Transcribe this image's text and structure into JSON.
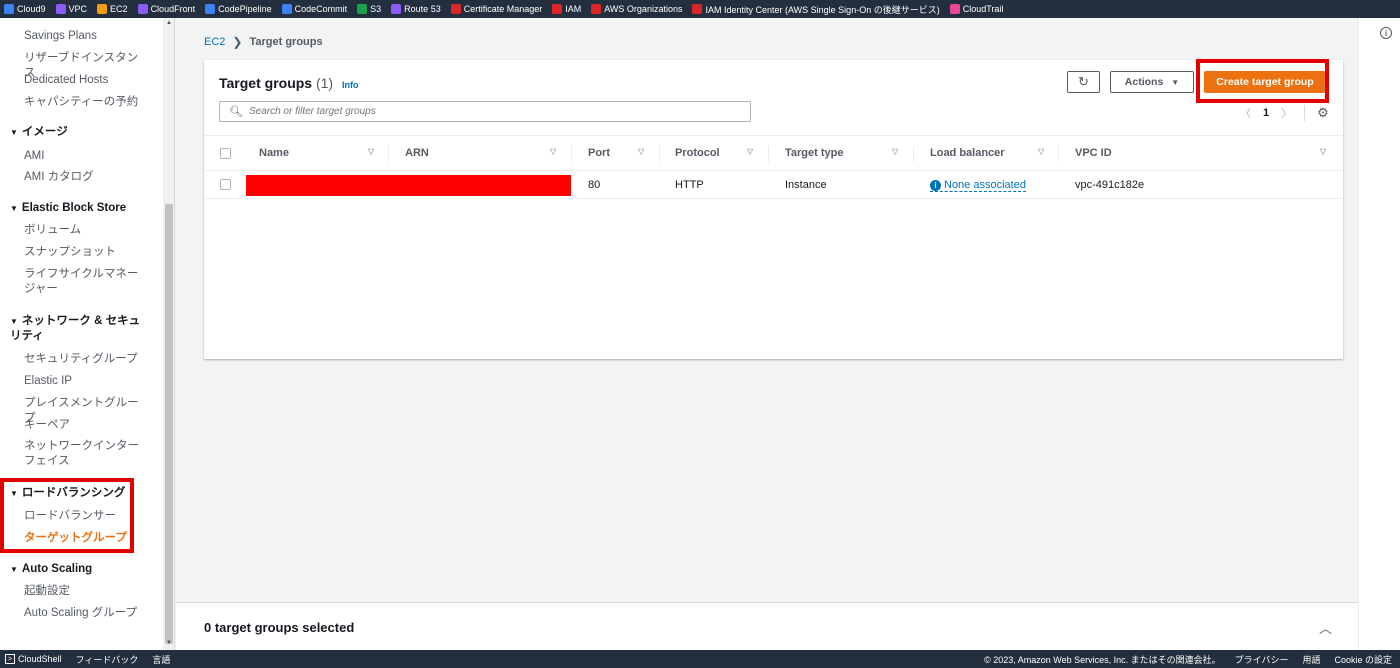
{
  "favorites": [
    {
      "label": "Cloud9",
      "color": "#3b82f6"
    },
    {
      "label": "VPC",
      "color": "#8b5cf6"
    },
    {
      "label": "EC2",
      "color": "#f59e0b"
    },
    {
      "label": "CloudFront",
      "color": "#8b5cf6"
    },
    {
      "label": "CodePipeline",
      "color": "#3b82f6"
    },
    {
      "label": "CodeCommit",
      "color": "#3b82f6"
    },
    {
      "label": "S3",
      "color": "#16a34a"
    },
    {
      "label": "Route 53",
      "color": "#8b5cf6"
    },
    {
      "label": "Certificate Manager",
      "color": "#dc2626"
    },
    {
      "label": "IAM",
      "color": "#dc2626"
    },
    {
      "label": "AWS Organizations",
      "color": "#dc2626"
    },
    {
      "label": "IAM Identity Center (AWS Single Sign-On の後継サービス)",
      "color": "#dc2626"
    },
    {
      "label": "CloudTrail",
      "color": "#ec4899"
    }
  ],
  "sidebar": {
    "items": {
      "savings": "Savings Plans",
      "reserved": "リザーブドインスタンス",
      "dedicated": "Dedicated Hosts",
      "capacity": "キャパシティーの予約",
      "images_head": "イメージ",
      "ami": "AMI",
      "ami_catalog": "AMI カタログ",
      "ebs_head": "Elastic Block Store",
      "volumes": "ボリューム",
      "snapshots": "スナップショット",
      "lifecycle": "ライフサイクルマネージャー",
      "network_head": "ネットワーク & セキュリティ",
      "sg": "セキュリティグループ",
      "eip": "Elastic IP",
      "placement": "プレイスメントグループ",
      "keypair": "キーペア",
      "eni": "ネットワークインターフェイス",
      "lb_head": "ロードバランシング",
      "lb": "ロードバランサー",
      "tg": "ターゲットグループ",
      "as_head": "Auto Scaling",
      "launch_cfg": "起動設定",
      "asg": "Auto Scaling グループ"
    }
  },
  "breadcrumb": {
    "root": "EC2",
    "sep": "❯",
    "current": "Target groups"
  },
  "panel": {
    "title": "Target groups",
    "count": "(1)",
    "info": "Info",
    "search_placeholder": "Search or filter target groups",
    "refresh_icon": "↻",
    "actions_label": "Actions",
    "create_label": "Create target group",
    "page": "1"
  },
  "table": {
    "columns": {
      "name": "Name",
      "arn": "ARN",
      "port": "Port",
      "protocol": "Protocol",
      "target_type": "Target type",
      "load_balancer": "Load balancer",
      "vpc_id": "VPC ID"
    },
    "rows": [
      {
        "port": "80",
        "protocol": "HTTP",
        "target_type": "Instance",
        "load_balancer": "None associated",
        "vpc_id": "vpc-491c182e"
      }
    ]
  },
  "split_panel": {
    "title": "0 target groups selected"
  },
  "bottombar": {
    "cloudshell": "CloudShell",
    "feedback": "フィードバック",
    "language": "言語",
    "copyright": "© 2023, Amazon Web Services, Inc. またはその関連会社。",
    "privacy": "プライバシー",
    "terms": "用語",
    "cookie": "Cookie の設定"
  },
  "colors": {
    "accent": "#ec7211",
    "link": "#0073bb",
    "highlight": "#e50000",
    "nav": "#232f3e"
  }
}
